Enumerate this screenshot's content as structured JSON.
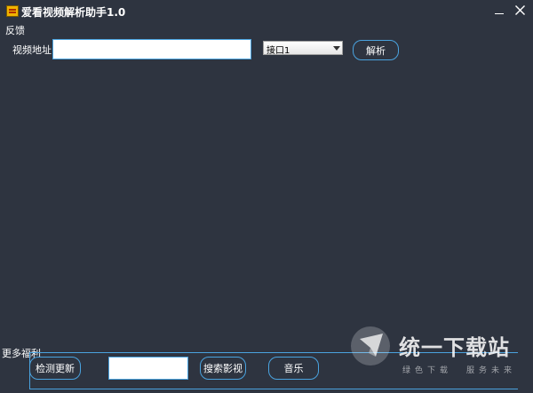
{
  "window": {
    "title": "爱看视频解析助手1.0",
    "minimize_icon": "minimize-icon",
    "close_icon": "close-icon"
  },
  "menu": {
    "feedback": "反馈"
  },
  "url_row": {
    "label": "视频地址",
    "input_value": "",
    "interface_selected": "接口1",
    "parse_button": "解析"
  },
  "welfare": {
    "label": "更多福利",
    "check_update": "检测更新",
    "search_value": "",
    "search_movies": "搜索影视",
    "music": "音乐"
  },
  "watermark": {
    "title": "统一下载站",
    "sub_left": "绿色下载",
    "sub_right": "服务未来"
  },
  "colors": {
    "background": "#2e3440",
    "accent_border": "#4aa3df",
    "text": "#ffffff"
  }
}
